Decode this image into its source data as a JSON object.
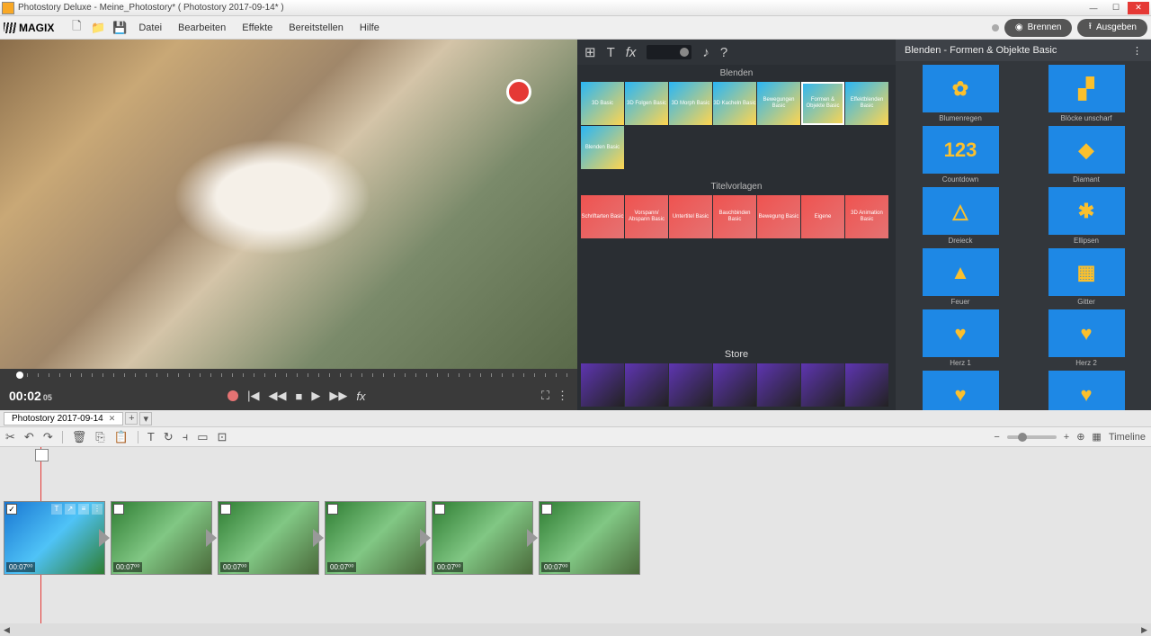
{
  "title": "Photostory Deluxe - Meine_Photostory* ( Photostory 2017-09-14* )",
  "logo": "MAGIX",
  "menus": [
    "Datei",
    "Bearbeiten",
    "Effekte",
    "Bereitstellen",
    "Hilfe"
  ],
  "actions": {
    "burn": "Brennen",
    "export": "Ausgeben"
  },
  "timecode": {
    "main": "00:02",
    "sub": "05"
  },
  "tab_name": "Photostory 2017-09-14",
  "view_label": "Timeline",
  "media": {
    "blend_label": "Blenden",
    "title_label": "Titelvorlagen",
    "store_label": "Store",
    "blends": [
      "3D Basic",
      "3D Folgen Basic",
      "3D Morph Basic",
      "3D Kacheln Basic",
      "Bewegungen Basic",
      "Formen & Objekte Basic",
      "Effektblenden Basic",
      "Blenden Basic"
    ],
    "titles": [
      "Schriftarten Basic",
      "Vorspann/ Abspann Basic",
      "Untertitel Basic",
      "Bauchbinden Basic",
      "Bewegung Basic",
      "Eigene",
      "3D Animation Basic"
    ],
    "selected_blend": 5
  },
  "effects": {
    "header": "Blenden - Formen & Objekte Basic",
    "items": [
      {
        "label": "Blumenregen",
        "glyph": "✿"
      },
      {
        "label": "Blöcke unscharf",
        "glyph": "▞"
      },
      {
        "label": "Countdown",
        "glyph": "123"
      },
      {
        "label": "Diamant",
        "glyph": "◆"
      },
      {
        "label": "Dreieck",
        "glyph": "△"
      },
      {
        "label": "Ellipsen",
        "glyph": "✱"
      },
      {
        "label": "Feuer",
        "glyph": "▲"
      },
      {
        "label": "Gitter",
        "glyph": "▦"
      },
      {
        "label": "Herz 1",
        "glyph": "♥"
      },
      {
        "label": "Herz 2",
        "glyph": "♥"
      },
      {
        "label": "",
        "glyph": "♥"
      },
      {
        "label": "",
        "glyph": "♥"
      }
    ]
  },
  "clips": [
    {
      "dur": "00:07⁰⁰",
      "checked": true
    },
    {
      "dur": "00:07⁰⁰"
    },
    {
      "dur": "00:07⁰⁰"
    },
    {
      "dur": "00:07⁰⁰"
    },
    {
      "dur": "00:07⁰⁰"
    },
    {
      "dur": "00:07⁰⁰"
    }
  ]
}
